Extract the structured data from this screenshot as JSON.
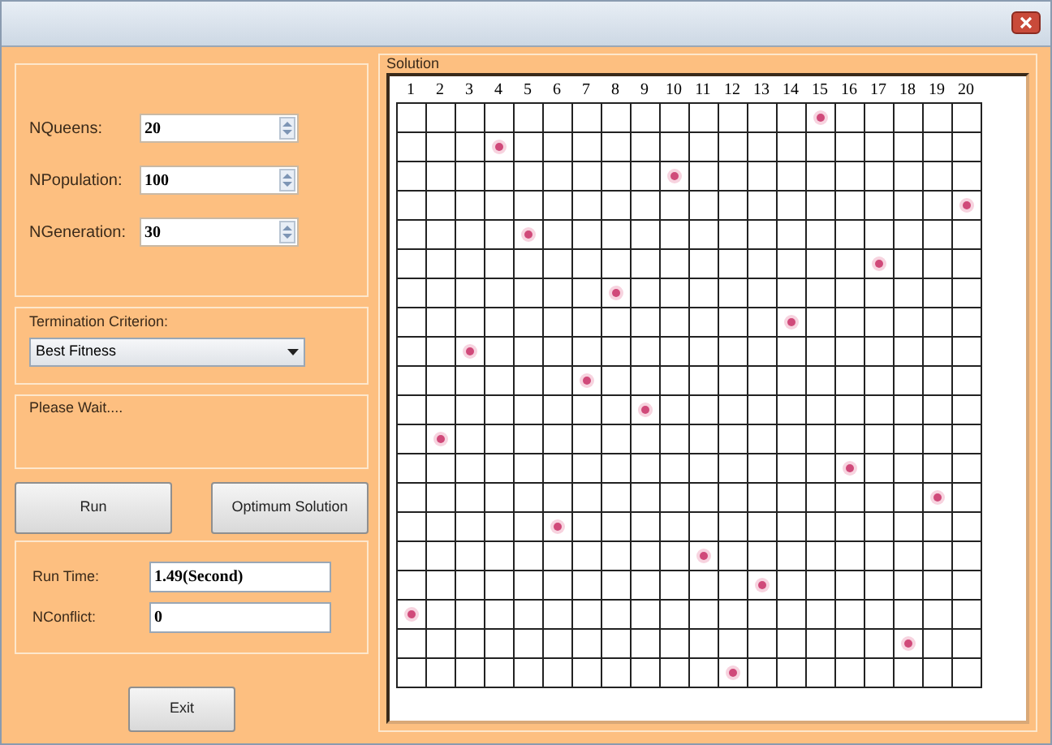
{
  "params": [
    {
      "label": "NQueens:",
      "value": "20"
    },
    {
      "label": "NPopulation:",
      "value": "100"
    },
    {
      "label": "NGeneration:",
      "value": "30"
    }
  ],
  "termination": {
    "legend": "Termination Criterion:",
    "value": "Best Fitness"
  },
  "status": {
    "legend": "Please Wait...."
  },
  "buttons": [
    "Run",
    "Optimum Solution"
  ],
  "results": [
    {
      "label": "Run Time:",
      "value": "1.49(Second)"
    },
    {
      "label": "NConflict:",
      "value": "0"
    }
  ],
  "exit_button": "Exit",
  "solution": {
    "legend": "Solution",
    "column_labels": [
      "1",
      "2",
      "3",
      "4",
      "5",
      "6",
      "7",
      "8",
      "9",
      "10",
      "11",
      "12",
      "13",
      "14",
      "15",
      "16",
      "17",
      "18",
      "19",
      "20"
    ],
    "rows": [
      {
        "cells": [
          false,
          false,
          false,
          false,
          false,
          false,
          false,
          false,
          false,
          false,
          false,
          false,
          false,
          false,
          true,
          false,
          false,
          false,
          false,
          false
        ]
      },
      {
        "cells": [
          false,
          false,
          false,
          true,
          false,
          false,
          false,
          false,
          false,
          false,
          false,
          false,
          false,
          false,
          false,
          false,
          false,
          false,
          false,
          false
        ]
      },
      {
        "cells": [
          false,
          false,
          false,
          false,
          false,
          false,
          false,
          false,
          false,
          true,
          false,
          false,
          false,
          false,
          false,
          false,
          false,
          false,
          false,
          false
        ]
      },
      {
        "cells": [
          false,
          false,
          false,
          false,
          false,
          false,
          false,
          false,
          false,
          false,
          false,
          false,
          false,
          false,
          false,
          false,
          false,
          false,
          false,
          true
        ]
      },
      {
        "cells": [
          false,
          false,
          false,
          false,
          true,
          false,
          false,
          false,
          false,
          false,
          false,
          false,
          false,
          false,
          false,
          false,
          false,
          false,
          false,
          false
        ]
      },
      {
        "cells": [
          false,
          false,
          false,
          false,
          false,
          false,
          false,
          false,
          false,
          false,
          false,
          false,
          false,
          false,
          false,
          false,
          true,
          false,
          false,
          false
        ]
      },
      {
        "cells": [
          false,
          false,
          false,
          false,
          false,
          false,
          false,
          true,
          false,
          false,
          false,
          false,
          false,
          false,
          false,
          false,
          false,
          false,
          false,
          false
        ]
      },
      {
        "cells": [
          false,
          false,
          false,
          false,
          false,
          false,
          false,
          false,
          false,
          false,
          false,
          false,
          false,
          true,
          false,
          false,
          false,
          false,
          false,
          false
        ]
      },
      {
        "cells": [
          false,
          false,
          true,
          false,
          false,
          false,
          false,
          false,
          false,
          false,
          false,
          false,
          false,
          false,
          false,
          false,
          false,
          false,
          false,
          false
        ]
      },
      {
        "cells": [
          false,
          false,
          false,
          false,
          false,
          false,
          true,
          false,
          false,
          false,
          false,
          false,
          false,
          false,
          false,
          false,
          false,
          false,
          false,
          false
        ]
      },
      {
        "cells": [
          false,
          false,
          false,
          false,
          false,
          false,
          false,
          false,
          true,
          false,
          false,
          false,
          false,
          false,
          false,
          false,
          false,
          false,
          false,
          false
        ]
      },
      {
        "cells": [
          false,
          true,
          false,
          false,
          false,
          false,
          false,
          false,
          false,
          false,
          false,
          false,
          false,
          false,
          false,
          false,
          false,
          false,
          false,
          false
        ]
      },
      {
        "cells": [
          false,
          false,
          false,
          false,
          false,
          false,
          false,
          false,
          false,
          false,
          false,
          false,
          false,
          false,
          false,
          true,
          false,
          false,
          false,
          false
        ]
      },
      {
        "cells": [
          false,
          false,
          false,
          false,
          false,
          false,
          false,
          false,
          false,
          false,
          false,
          false,
          false,
          false,
          false,
          false,
          false,
          false,
          true,
          false
        ]
      },
      {
        "cells": [
          false,
          false,
          false,
          false,
          false,
          true,
          false,
          false,
          false,
          false,
          false,
          false,
          false,
          false,
          false,
          false,
          false,
          false,
          false,
          false
        ]
      },
      {
        "cells": [
          false,
          false,
          false,
          false,
          false,
          false,
          false,
          false,
          false,
          false,
          true,
          false,
          false,
          false,
          false,
          false,
          false,
          false,
          false,
          false
        ]
      },
      {
        "cells": [
          false,
          false,
          false,
          false,
          false,
          false,
          false,
          false,
          false,
          false,
          false,
          false,
          true,
          false,
          false,
          false,
          false,
          false,
          false,
          false
        ]
      },
      {
        "cells": [
          true,
          false,
          false,
          false,
          false,
          false,
          false,
          false,
          false,
          false,
          false,
          false,
          false,
          false,
          false,
          false,
          false,
          false,
          false,
          false
        ]
      },
      {
        "cells": [
          false,
          false,
          false,
          false,
          false,
          false,
          false,
          false,
          false,
          false,
          false,
          false,
          false,
          false,
          false,
          false,
          false,
          true,
          false,
          false
        ]
      },
      {
        "cells": [
          false,
          false,
          false,
          false,
          false,
          false,
          false,
          false,
          false,
          false,
          false,
          true,
          false,
          false,
          false,
          false,
          false,
          false,
          false,
          false
        ]
      }
    ]
  }
}
